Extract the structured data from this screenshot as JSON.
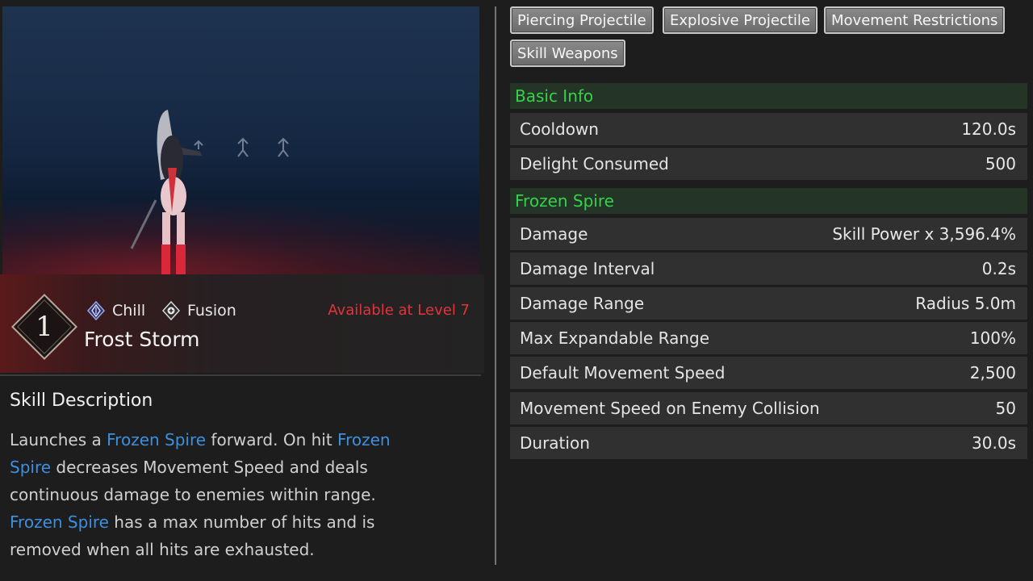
{
  "skill": {
    "number": "1",
    "tags": [
      {
        "label": "Chill",
        "icon": "chill-element-icon"
      },
      {
        "label": "Fusion",
        "icon": "fusion-type-icon"
      }
    ],
    "name": "Frost Storm",
    "availability": "Available at Level 7"
  },
  "description": {
    "title": "Skill Description",
    "segments": [
      {
        "text": "Launches a ",
        "highlight": false
      },
      {
        "text": "Frozen Spire",
        "highlight": true
      },
      {
        "text": " forward. On hit ",
        "highlight": false
      },
      {
        "text": "Frozen Spire",
        "highlight": true
      },
      {
        "text": " decreases Movement Speed and deals continuous damage to enemies within range. ",
        "highlight": false
      },
      {
        "text": "Frozen Spire",
        "highlight": true
      },
      {
        "text": " has a max number of hits and is removed when all hits are exhausted.",
        "highlight": false
      }
    ]
  },
  "attribute_chips": [
    "Piercing Projectile",
    "Explosive Projectile",
    "Movement Restrictions",
    "Skill Weapons"
  ],
  "sections": [
    {
      "title": "Basic Info",
      "rows": [
        {
          "label": "Cooldown",
          "value": "120.0s"
        },
        {
          "label": "Delight Consumed",
          "value": "500"
        }
      ]
    },
    {
      "title": "Frozen Spire",
      "rows": [
        {
          "label": "Damage",
          "value": "Skill Power x 3,596.4%"
        },
        {
          "label": "Damage Interval",
          "value": "0.2s"
        },
        {
          "label": "Damage Range",
          "value": "Radius 5.0m"
        },
        {
          "label": "Max Expandable Range",
          "value": "100%"
        },
        {
          "label": "Default Movement Speed",
          "value": "2,500"
        },
        {
          "label": "Movement Speed on Enemy Collision",
          "value": "50"
        },
        {
          "label": "Duration",
          "value": "30.0s"
        }
      ]
    }
  ],
  "colors": {
    "highlight": "#3d8fe0",
    "section_title": "#35d24a",
    "availability": "#e0353a"
  }
}
